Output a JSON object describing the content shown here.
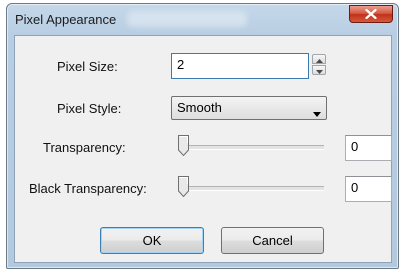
{
  "window": {
    "title": "Pixel Appearance",
    "close_label": "X"
  },
  "fields": {
    "pixel_size": {
      "label": "Pixel Size:",
      "value": "2"
    },
    "pixel_style": {
      "label": "Pixel Style:",
      "selected": "Smooth"
    },
    "transparency": {
      "label": "Transparency:",
      "value": "0",
      "slider_level": 0
    },
    "black_transparency": {
      "label": "Black Transparency:",
      "value": "0",
      "slider_level": 0
    }
  },
  "buttons": {
    "ok": "OK",
    "cancel": "Cancel"
  },
  "icons": {
    "close": "close-icon",
    "spin_up": "arrow-up-icon",
    "spin_down": "arrow-down-icon",
    "dropdown": "dropdown-arrow-icon"
  },
  "colors": {
    "titlebar": "#b9cee3",
    "close_button": "#c7412a",
    "dialog_body": "#f0f0f0",
    "focus_border": "#3d7bad"
  }
}
